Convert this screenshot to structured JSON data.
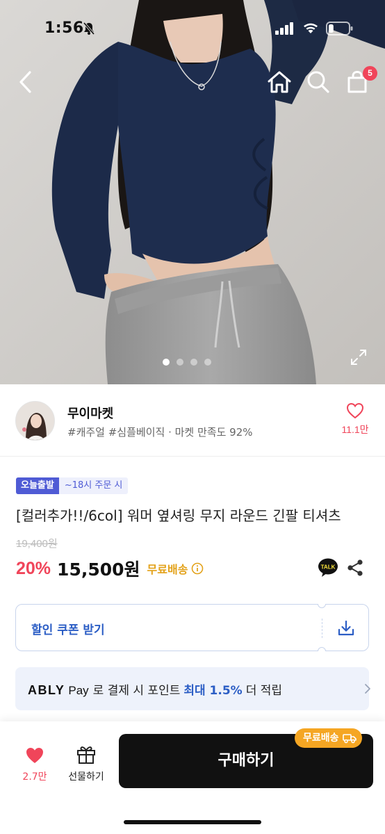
{
  "status_bar": {
    "time": "1:56",
    "battery_level": 0.25
  },
  "header": {
    "cart_badge": "5"
  },
  "gallery": {
    "total_images": 4,
    "active_index": 0
  },
  "seller": {
    "name": "무이마켓",
    "tags": "#캐주얼 #심플베이직 · 마켓 만족도 92%",
    "like_count": "11.1만"
  },
  "product": {
    "badge_delivery": "오늘출발",
    "badge_order_time": "~18시 주문 시",
    "title": "[컬러추가!!/6col] 워머 옆셔링 무지 라운드 긴팔 티셔츠",
    "original_price": "19,400원",
    "discount": "20%",
    "price": "15,500원",
    "shipping": "무료배송",
    "talk_label": "TALK"
  },
  "coupon": {
    "label": "할인 쿠폰 받기"
  },
  "pay_banner": {
    "logo": "ABLY",
    "pay": "Pay",
    "text_before": "로 결제 시 포인트",
    "highlight": "최대 1.5%",
    "text_after": "더 적립"
  },
  "bottom_bar": {
    "like_count": "2.7만",
    "gift_label": "선물하기",
    "shipping_chip": "무료배송",
    "buy_label": "구매하기"
  },
  "colors": {
    "accent_red": "#f0455a",
    "accent_blue": "#2c5ec5",
    "badge_blue": "#4f5bd5",
    "shipping_orange": "#e3a21a",
    "buy_button": "#111111"
  }
}
